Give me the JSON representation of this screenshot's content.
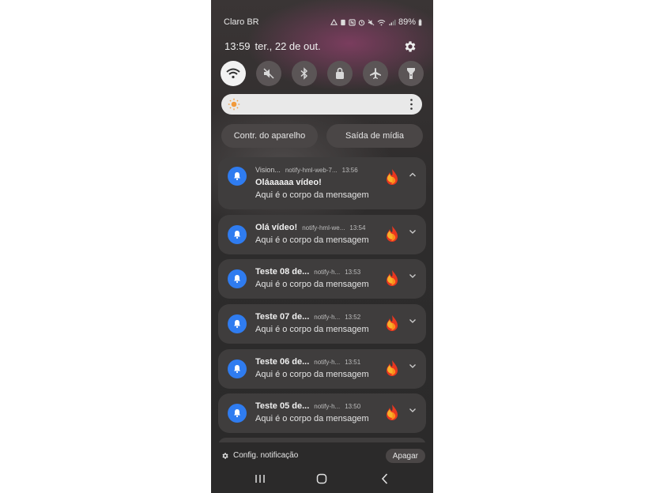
{
  "status_bar": {
    "carrier": "Claro BR",
    "icons": [
      "drive-icon",
      "notification-icon",
      "nfc-icon",
      "alarm-icon",
      "mute-icon",
      "wifi-icon",
      "signal-icon"
    ],
    "battery": "89%"
  },
  "header": {
    "time": "13:59",
    "date": "ter., 22 de out."
  },
  "quick_settings": [
    {
      "name": "wifi",
      "active": true
    },
    {
      "name": "sound-muted",
      "active": false
    },
    {
      "name": "bluetooth",
      "active": false
    },
    {
      "name": "screen-lock",
      "active": false
    },
    {
      "name": "airplane-mode",
      "active": false
    },
    {
      "name": "flashlight",
      "active": false
    }
  ],
  "brightness": {
    "level": 0.05
  },
  "buttons": {
    "device_control": "Contr. do aparelho",
    "media_output": "Saída de mídia"
  },
  "notifications": [
    {
      "title": "Vision...",
      "app": "notify-hml-web-7...",
      "time": "13:56",
      "line1": "Oláaaaaa vídeo!",
      "body": "Aqui é o corpo da mensagem",
      "expanded": true
    },
    {
      "title": "Olá vídeo!",
      "app": "notify-hml-we...",
      "time": "13:54",
      "body": "Aqui é o corpo da mensagem",
      "expanded": false
    },
    {
      "title": "Teste 08 de...",
      "app": "notify-h...",
      "time": "13:53",
      "body": "Aqui é o corpo da mensagem",
      "expanded": false
    },
    {
      "title": "Teste 07 de...",
      "app": "notify-h...",
      "time": "13:52",
      "body": "Aqui é o corpo da mensagem",
      "expanded": false
    },
    {
      "title": "Teste 06 de...",
      "app": "notify-h...",
      "time": "13:51",
      "body": "Aqui é o corpo da mensagem",
      "expanded": false
    },
    {
      "title": "Teste 05 de...",
      "app": "notify-h...",
      "time": "13:50",
      "body": "Aqui é o corpo da mensagem",
      "expanded": false
    }
  ],
  "footer": {
    "settings_label": "Config. notificação",
    "clear_label": "Apagar"
  },
  "colors": {
    "bell_blue": "#2f7cf0",
    "panel_bg": "#3f3d3d",
    "sun_orange": "#f29a3a"
  }
}
